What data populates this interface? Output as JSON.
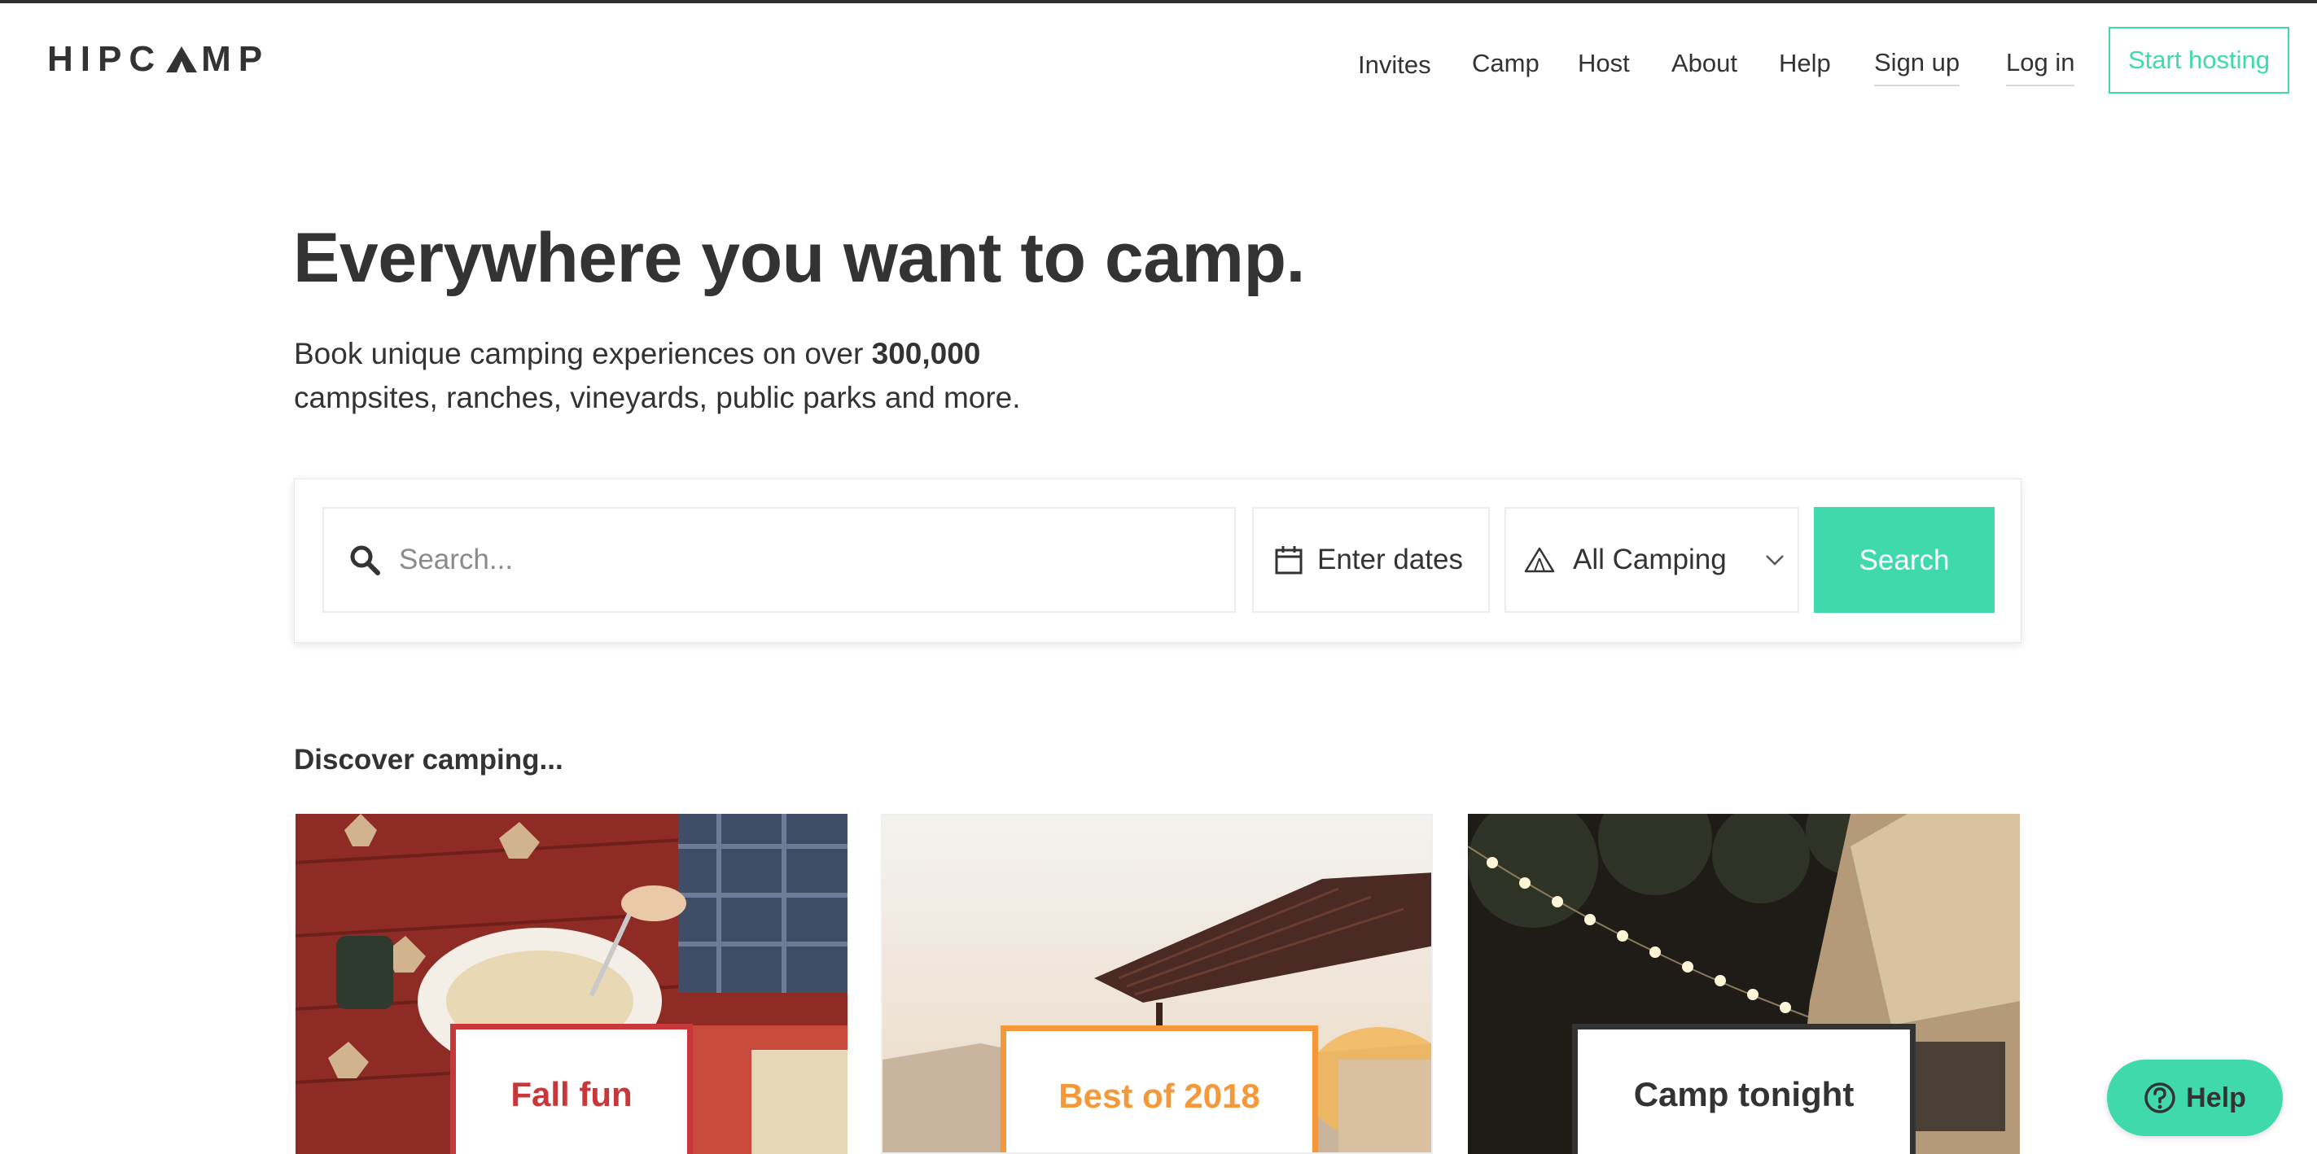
{
  "brand": {
    "logo_left": "HIPC",
    "logo_right": "MP",
    "accent_color": "#40d9ac"
  },
  "nav": {
    "items": [
      {
        "label": "Invites"
      },
      {
        "label": "Camp"
      },
      {
        "label": "Host"
      },
      {
        "label": "About"
      },
      {
        "label": "Help"
      },
      {
        "label": "Sign up"
      },
      {
        "label": "Log in"
      }
    ],
    "start_hosting": "Start hosting"
  },
  "hero": {
    "title": "Everywhere you want to camp.",
    "subtitle_prefix": "Book unique camping experiences on over ",
    "subtitle_count": "300,000",
    "subtitle_suffix": "campsites, ranches, vineyards, public parks and more."
  },
  "search": {
    "placeholder": "Search...",
    "dates_label": "Enter dates",
    "type_selected": "All Camping",
    "button_label": "Search",
    "icons": [
      "search-icon",
      "calendar-icon",
      "tent-icon",
      "chevron-down-icon"
    ]
  },
  "discover": {
    "heading": "Discover camping...",
    "cards": [
      {
        "label": "Fall fun",
        "color": "#c8373a"
      },
      {
        "label": "Best of 2018",
        "color": "#f4983a"
      },
      {
        "label": "Camp tonight",
        "color": "#333333"
      }
    ]
  },
  "help": {
    "label": "Help",
    "icon": "question-circle-icon"
  }
}
